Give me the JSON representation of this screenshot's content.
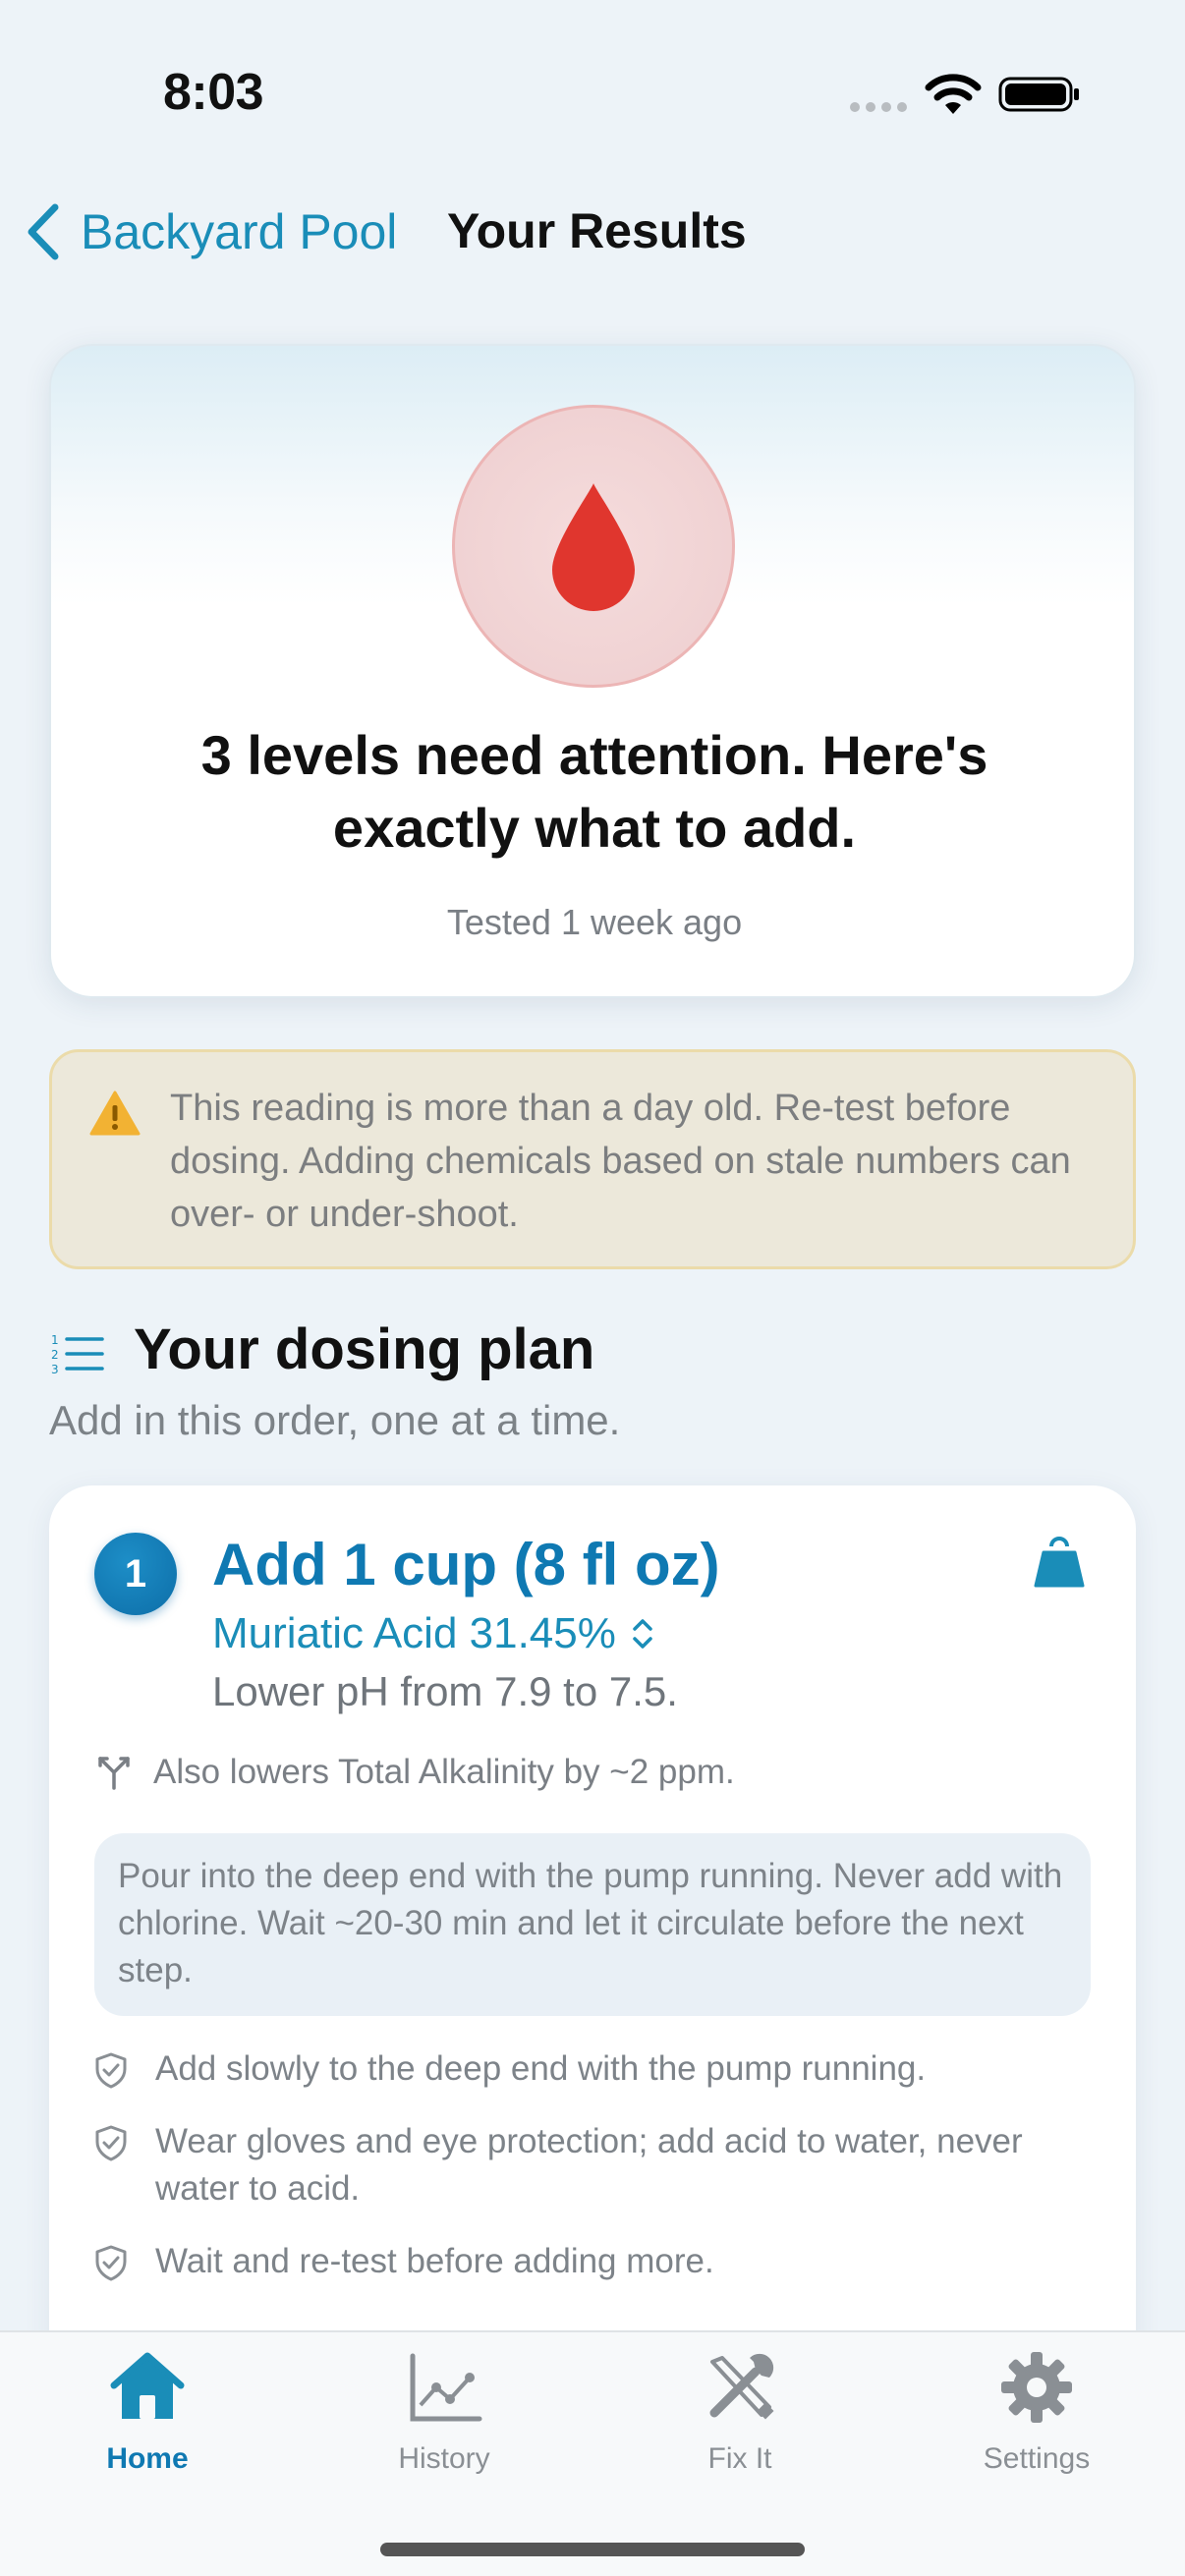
{
  "status_bar": {
    "time": "8:03"
  },
  "nav": {
    "back_label": "Backyard Pool",
    "title": "Your Results"
  },
  "hero": {
    "icon": "water-drop-icon",
    "headline": "3 levels need attention. Here's exactly what to add.",
    "tested": "Tested 1 week ago",
    "accent_color": "#e0362e"
  },
  "warning": {
    "icon": "warning-triangle-icon",
    "text": "This reading is more than a day old. Re-test before dosing. Adding chemicals based on stale numbers can over- or under-shoot."
  },
  "section": {
    "icon": "numbered-list-icon",
    "title": "Your dosing plan",
    "subtitle": "Add in this order, one at a time."
  },
  "dose": {
    "step": "1",
    "amount": "Add 1 cup (8 fl oz)",
    "chemical": "Muriatic Acid 31.45%",
    "purpose": "Lower pH from 7.9 to 7.5.",
    "side_effect": "Also lowers Total Alkalinity by ~2 ppm.",
    "instruction": "Pour into the deep end with the pump running. Never add with chlorine. Wait ~20-30 min and let it circulate before the next step.",
    "tips": [
      "Add slowly to the deep end with the pump running.",
      "Wear gloves and eye protection; add acid to water, never water to acid.",
      "Wait and re-test before adding more."
    ],
    "accent_color": "#0f79b2"
  },
  "tabs": [
    {
      "label": "Home",
      "icon": "house-icon",
      "active": true
    },
    {
      "label": "History",
      "icon": "chart-icon",
      "active": false
    },
    {
      "label": "Fix It",
      "icon": "tools-icon",
      "active": false
    },
    {
      "label": "Settings",
      "icon": "gear-icon",
      "active": false
    }
  ]
}
